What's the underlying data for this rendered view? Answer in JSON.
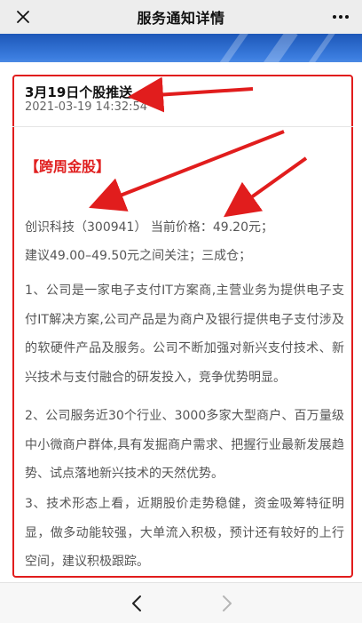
{
  "topbar": {
    "title": "服务通知详情",
    "close_icon": "close-icon",
    "more_icon": "more-icon"
  },
  "message": {
    "title": "3月19日个股推送",
    "time": "2021-03-19 14:32:54",
    "tag": "【跨周金股】",
    "line1": "创识科技（300941）   当前价格：49.20元；",
    "line2": "建议49.00–49.50元之间关注；三成仓；",
    "para1": "1、公司是一家电子支付IT方案商,主营业务为提供电子支付IT解决方案,公司产品是为商户及银行提供电子支付涉及的软硬件产品及服务。公司不断加强对新兴支付技术、新兴技术与支付融合的研发投入，竞争优势明显。",
    "para2": "2、公司服务近30个行业、3000多家大型商户、百万量级中小微商户群体,具有发掘商户需求、把握行业最新发展趋势、试点落地新兴技术的天然优势。",
    "para3": "3、技术形态上看，近期股价走势稳健，资金吸筹特征明显，做多动能较强，大单流入积极，预计还有较好的上行空间，建议积极跟踪。"
  },
  "colors": {
    "accent_red": "#e11d1d",
    "banner_blue": "#2a66c8"
  },
  "bottombar": {
    "back_icon": "chevron-left-icon",
    "forward_icon": "chevron-right-icon"
  }
}
